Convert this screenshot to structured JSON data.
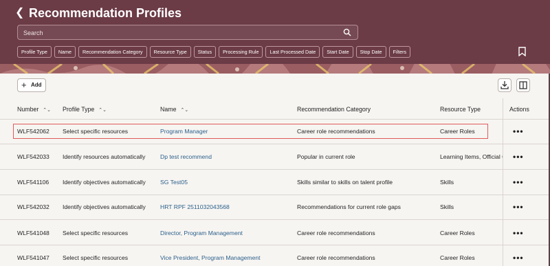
{
  "header": {
    "title": "Recommendation Profiles",
    "search_placeholder": "Search",
    "filters": [
      "Profile Type",
      "Name",
      "Recommendation Category",
      "Resource Type",
      "Status",
      "Processing Rule",
      "Last Processed Date",
      "Start Date",
      "Stop Date",
      "Filters"
    ]
  },
  "toolbar": {
    "add_label": "Add"
  },
  "table": {
    "columns": [
      "Number",
      "Profile Type",
      "Name",
      "Recommendation Category",
      "Resource Type",
      "Actions"
    ],
    "rows": [
      {
        "number": "WLF542062",
        "profile_type": "Select specific resources",
        "name": "Program Manager",
        "category": "Career role recommendations",
        "resource_type": "Career Roles"
      },
      {
        "number": "WLF542033",
        "profile_type": "Identify resources automatically",
        "name": "Dp test recommend",
        "category": "Popular in current role",
        "resource_type": "Learning Items, Official C"
      },
      {
        "number": "WLF541106",
        "profile_type": "Identify objectives automatically",
        "name": "SG Test05",
        "category": "Skills similar to skills on talent profile",
        "resource_type": "Skills"
      },
      {
        "number": "WLF542032",
        "profile_type": "Identify objectives automatically",
        "name": "HRT RPF 2511032043568",
        "category": "Recommendations for current role gaps",
        "resource_type": "Skills"
      },
      {
        "number": "WLF541048",
        "profile_type": "Select specific resources",
        "name": "Director, Program Management",
        "category": "Career role recommendations",
        "resource_type": "Career Roles"
      },
      {
        "number": "WLF541047",
        "profile_type": "Select specific resources",
        "name": "Vice President, Program Management",
        "category": "Career role recommendations",
        "resource_type": "Career Roles"
      }
    ],
    "action_glyph": "•••"
  },
  "colors": {
    "header_bg": "#6b3b46",
    "link": "#2a5f8a",
    "highlight": "#e05a5a"
  }
}
